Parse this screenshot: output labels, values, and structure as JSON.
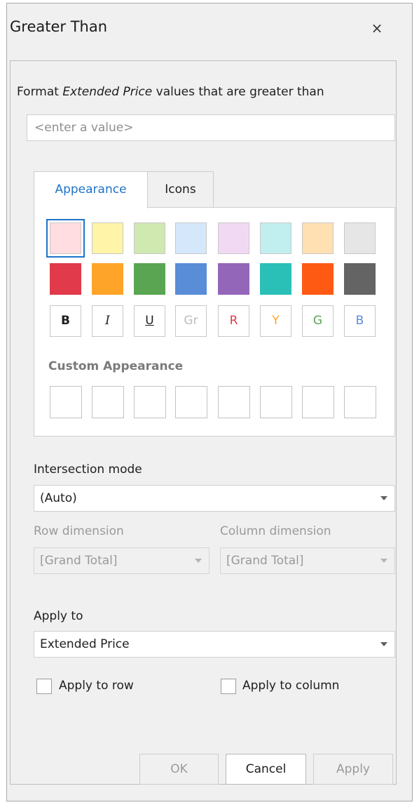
{
  "dialog": {
    "title": "Greater Than",
    "close_label": "×",
    "prompt_prefix": "Format ",
    "prompt_field": "Extended Price",
    "prompt_suffix": " values that are greater than",
    "value_placeholder": "<enter a value>"
  },
  "tabs": [
    {
      "label": "Appearance",
      "active": true
    },
    {
      "label": "Icons",
      "active": false
    }
  ],
  "appearance": {
    "light_swatches": [
      "#ffdde1",
      "#fff4a8",
      "#cfe9b0",
      "#d5e8fb",
      "#f2d9f3",
      "#c1eeee",
      "#ffe0b2",
      "#e6e6e6"
    ],
    "dark_swatches": [
      "#e03a4b",
      "#fea428",
      "#5aa552",
      "#5a8dd8",
      "#9466b9",
      "#2ac0b7",
      "#ff5a14",
      "#646464"
    ],
    "selected_swatch": "#ffdde1",
    "format_buttons": [
      {
        "text": "B",
        "color": "#1e1e1e",
        "style": "bold"
      },
      {
        "text": "I",
        "color": "#1e1e1e",
        "style": "italic"
      },
      {
        "text": "U",
        "color": "#1e1e1e",
        "style": "underline"
      },
      {
        "text": "Gr",
        "color": "#bdbdbd",
        "style": "normal"
      },
      {
        "text": "R",
        "color": "#e03a4b",
        "style": "normal"
      },
      {
        "text": "Y",
        "color": "#fea428",
        "style": "normal"
      },
      {
        "text": "G",
        "color": "#5aa552",
        "style": "normal"
      },
      {
        "text": "B",
        "color": "#5a8dd8",
        "style": "normal"
      }
    ],
    "custom_label": "Custom Appearance",
    "custom_slot_count": 8
  },
  "intersection": {
    "label": "Intersection mode",
    "value": "(Auto)",
    "row_label": "Row dimension",
    "row_value": "[Grand Total]",
    "column_label": "Column dimension",
    "column_value": "[Grand Total]"
  },
  "apply": {
    "label": "Apply to",
    "value": "Extended Price",
    "row_checkbox": "Apply to row",
    "column_checkbox": "Apply to column"
  },
  "buttons": {
    "ok": "OK",
    "cancel": "Cancel",
    "apply": "Apply"
  },
  "colors": {
    "accent": "#1e73c8",
    "dialog_bg": "#f0f0f0"
  }
}
